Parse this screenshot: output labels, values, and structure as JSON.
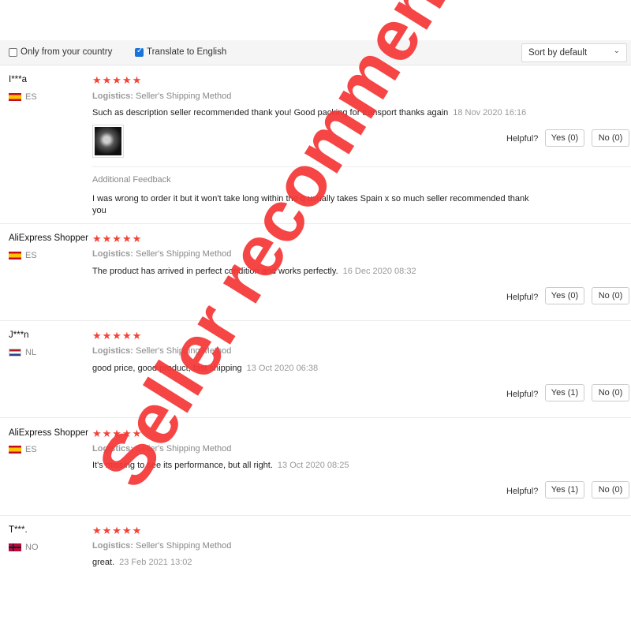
{
  "filters": {
    "only_country_label": "Only from your country",
    "translate_label": "Translate to English",
    "sort_value": "Sort by default"
  },
  "labels": {
    "logistics": "Logistics:",
    "helpful": "Helpful?",
    "additional_feedback": "Additional Feedback"
  },
  "reviews": [
    {
      "name": "I***a",
      "country": "ES",
      "stars": "★★★★★",
      "logistics": "Seller's Shipping Method",
      "text": "Such as description seller recommended thank you! Good packing for transport thanks again",
      "date": "18 Nov 2020 16:16",
      "yes": "Yes (0)",
      "no": "No (0)",
      "additional_text": "I was wrong to order it but it won't take long within the q usually takes Spain x so much seller recommended thank you"
    },
    {
      "name": "AliExpress Shopper",
      "country": "ES",
      "stars": "★★★★★",
      "logistics": "Seller's Shipping Method",
      "text": "The product has arrived in perfect condition and works perfectly.",
      "date": "16 Dec 2020 08:32",
      "yes": "Yes (0)",
      "no": "No (0)"
    },
    {
      "name": "J***n",
      "country": "NL",
      "stars": "★★★★★",
      "logistics": "Seller's Shipping Method",
      "text": "good price, good product, fast shipping",
      "date": "13 Oct 2020 06:38",
      "yes": "Yes (1)",
      "no": "No (0)"
    },
    {
      "name": "AliExpress Shopper",
      "country": "ES",
      "stars": "★★★★★",
      "logistics": "Seller's Shipping Method",
      "text": "It's missing to see its performance, but all right.",
      "date": "13 Oct 2020 08:25",
      "yes": "Yes (1)",
      "no": "No (0)"
    },
    {
      "name": "T***.",
      "country": "NO",
      "stars": "★★★★★",
      "logistics": "Seller's Shipping Method",
      "text": "great.",
      "date": "23 Feb 2021 13:02"
    }
  ],
  "watermark": "Seller recommend",
  "colors": {
    "star": "#f44336",
    "watermark": "#f43737",
    "checkbox": "#1b74d8"
  }
}
